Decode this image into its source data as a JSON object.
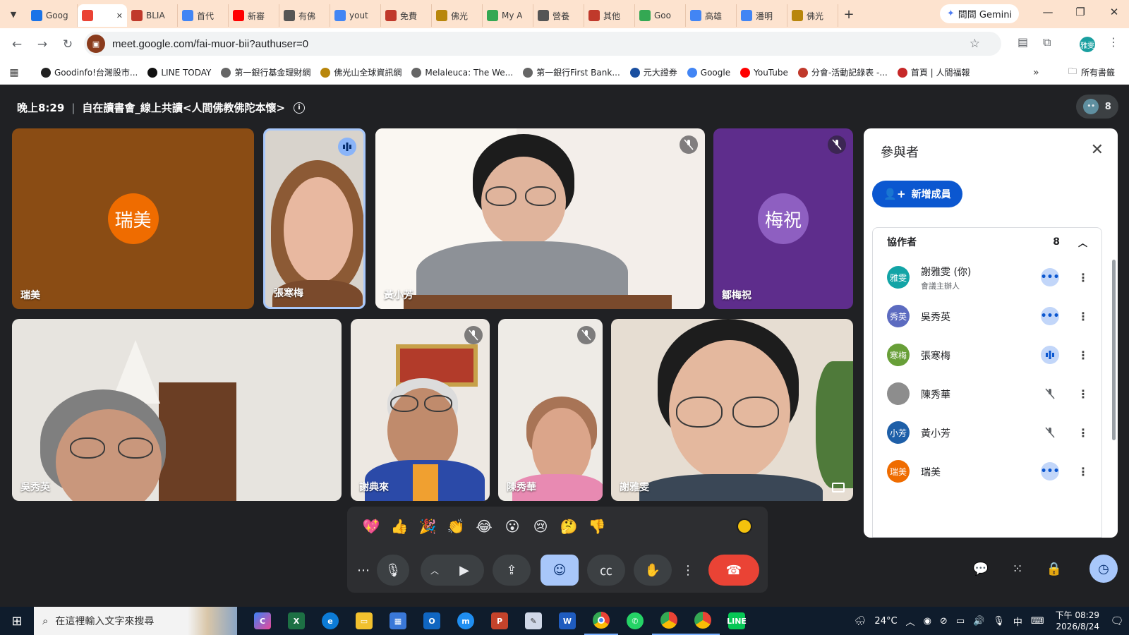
{
  "browser": {
    "tabs": [
      {
        "label": "Goog",
        "icon": "calendar-icon",
        "color": "#1a73e8"
      },
      {
        "label": "",
        "icon": "meet-icon",
        "color": "#ea4335",
        "active": true
      },
      {
        "label": "BLIA",
        "icon": "blia-icon",
        "color": "#c0392b"
      },
      {
        "label": "首代",
        "icon": "google-icon",
        "color": "#4285f4"
      },
      {
        "label": "新審",
        "icon": "youtube-icon",
        "color": "#ff0000"
      },
      {
        "label": "有佛",
        "icon": "globe-icon",
        "color": "#555555"
      },
      {
        "label": "yout",
        "icon": "google-icon",
        "color": "#4285f4"
      },
      {
        "label": "免費",
        "icon": "shield-icon",
        "color": "#c0392b"
      },
      {
        "label": "佛光",
        "icon": "fgs-icon",
        "color": "#b8860b"
      },
      {
        "label": "My A",
        "icon": "person-icon",
        "color": "#34a853"
      },
      {
        "label": "營養",
        "icon": "leaf-icon",
        "color": "#555555"
      },
      {
        "label": "其他",
        "icon": "blia-icon",
        "color": "#c0392b"
      },
      {
        "label": "Goo",
        "icon": "maps-icon",
        "color": "#34a853"
      },
      {
        "label": "高雄",
        "icon": "google-icon",
        "color": "#4285f4"
      },
      {
        "label": "潘明",
        "icon": "google-icon",
        "color": "#4285f4"
      },
      {
        "label": "佛光",
        "icon": "fgs-icon",
        "color": "#b8860b"
      }
    ],
    "gemini_label": "問問 Gemini",
    "url": "meet.google.com/fai-muor-bii?authuser=0",
    "profile_initials": "雅雯",
    "bookmarks": [
      {
        "label": "Goodinfo!台灣股市...",
        "icon": "goodinfo-icon",
        "color": "#222222"
      },
      {
        "label": "LINE TODAY",
        "icon": "line-today-icon",
        "color": "#111111"
      },
      {
        "label": "第一銀行基金理財網",
        "icon": "globe-icon",
        "color": "#666666"
      },
      {
        "label": "佛光山全球資訊網",
        "icon": "fgs-icon",
        "color": "#b8860b"
      },
      {
        "label": "Melaleuca: The We...",
        "icon": "leaf-icon",
        "color": "#666666"
      },
      {
        "label": "第一銀行First Bank...",
        "icon": "globe-icon",
        "color": "#666666"
      },
      {
        "label": "元大證券",
        "icon": "yuanta-icon",
        "color": "#1a4fa0"
      },
      {
        "label": "Google",
        "icon": "google-icon",
        "color": "#4285f4"
      },
      {
        "label": "YouTube",
        "icon": "youtube-icon",
        "color": "#ff0000"
      },
      {
        "label": "分會-活動記錄表 -...",
        "icon": "blia-icon",
        "color": "#c0392b"
      },
      {
        "label": "首頁 | 人間福報",
        "icon": "news-icon",
        "color": "#c62828"
      }
    ],
    "all_bookmarks_label": "所有書籤"
  },
  "meeting": {
    "time": "晚上8:29",
    "title": "自在讀書會_線上共讀<人間佛教佛陀本懷>",
    "participant_count": "8"
  },
  "tiles": [
    {
      "name": "瑞美",
      "initials": "瑞美",
      "type": "avatar",
      "mic": "none"
    },
    {
      "name": "張寒梅",
      "type": "video",
      "mic": "speaking"
    },
    {
      "name": "黃小芳",
      "type": "video",
      "mic": "muted"
    },
    {
      "name": "鄒梅祝",
      "initials": "梅祝",
      "type": "avatar",
      "mic": "muted"
    },
    {
      "name": "吳秀英",
      "type": "video",
      "mic": "none"
    },
    {
      "name": "謝典來",
      "type": "video",
      "mic": "muted"
    },
    {
      "name": "陳秀華",
      "type": "video",
      "mic": "muted"
    },
    {
      "name": "謝雅雯",
      "type": "video",
      "mic": "none"
    }
  ],
  "panel": {
    "title": "參與者",
    "add_label": "新增成員",
    "section_label": "協作者",
    "section_count": "8",
    "people": [
      {
        "initials": "雅雯",
        "name": "謝雅雯 (你)",
        "sub": "會議主辦人",
        "color": "#12a4a6",
        "status": "dots"
      },
      {
        "initials": "秀英",
        "name": "吳秀英",
        "sub": "",
        "color": "#5c6bc0",
        "status": "dots"
      },
      {
        "initials": "寒梅",
        "name": "張寒梅",
        "sub": "",
        "color": "#689f38",
        "status": "talk"
      },
      {
        "initials": "",
        "name": "陳秀華",
        "sub": "",
        "color": "#8d8d8d",
        "status": "muted"
      },
      {
        "initials": "小芳",
        "name": "黃小芳",
        "sub": "",
        "color": "#1e5fa8",
        "status": "muted"
      },
      {
        "initials": "瑞美",
        "name": "瑞美",
        "sub": "",
        "color": "#ef6c00",
        "status": "dots"
      }
    ]
  },
  "reactions": [
    "💖",
    "👍",
    "🎉",
    "👏",
    "😂",
    "😮",
    "😢",
    "🤔",
    "👎"
  ],
  "taskbar": {
    "search_placeholder": "在這裡輸入文字來搜尋",
    "weather": "24°C",
    "ime": "中",
    "time": "下午 08:29",
    "date": "2026/8/24"
  }
}
